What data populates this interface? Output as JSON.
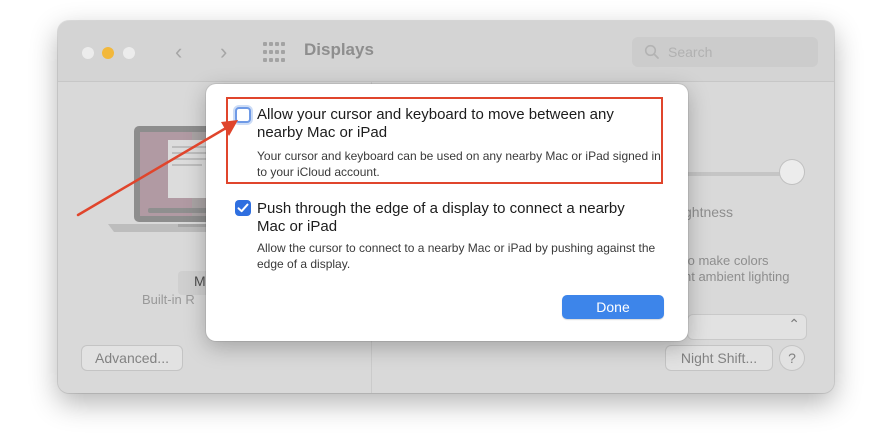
{
  "window": {
    "title": "Displays",
    "search_placeholder": "Search",
    "back_glyph": "‹",
    "forward_glyph": "›"
  },
  "sidebar": {
    "display_name_fragment": "M",
    "display_sub": "Built-in R"
  },
  "settings": {
    "brightness_label_fragment": "ghtness",
    "ambient_line1": "to make colors",
    "ambient_line2": "nt ambient lighting",
    "advanced_button": "Advanced...",
    "night_shift_button": "Night Shift...",
    "help_button": "?"
  },
  "sheet": {
    "option1": {
      "title": "Allow your cursor and keyboard to move between any nearby Mac or iPad",
      "description": "Your cursor and keyboard can be used on any nearby Mac or iPad signed in to your iCloud account.",
      "checked": false
    },
    "option2": {
      "title": "Push through the edge of a display to connect a nearby Mac or iPad",
      "description": "Allow the cursor to connect to a nearby Mac or iPad by pushing against the edge of a display.",
      "checked": true
    },
    "done_button": "Done"
  },
  "colors": {
    "accent": "#3d85ea",
    "highlight": "#e0452c",
    "minimize": "#f2b83c"
  }
}
